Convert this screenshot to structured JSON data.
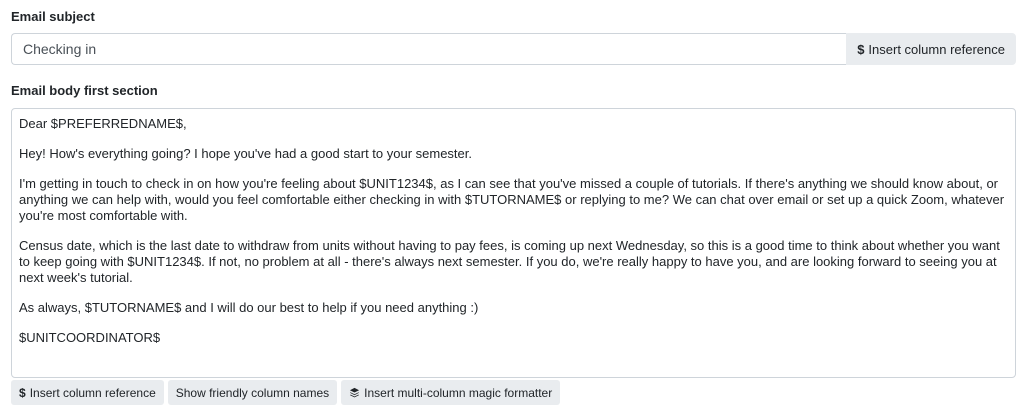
{
  "subject": {
    "label": "Email subject",
    "value": "Checking in",
    "insert_button_label": "Insert column reference"
  },
  "body": {
    "label": "Email body first section",
    "paragraphs": [
      "Dear $PREFERREDNAME$,",
      "Hey! How's everything going? I hope you've had a good start to your semester.",
      "I'm getting in touch to check in on how you're feeling about $UNIT1234$, as I can see that you've missed a couple of tutorials. If there's anything we should know about, or anything we can help with, would you feel comfortable either checking in with $TUTORNAME$ or replying to me? We can chat over email or set up a quick Zoom, whatever you're most comfortable with.",
      "Census date, which is the last date to withdraw from units without having to pay fees, is coming up next Wednesday, so this is a good time to think about whether you want to keep going with $UNIT1234$. If not, no problem at all - there's always next semester. If you do, we're really happy to have you, and are looking forward to seeing you at next week's tutorial.",
      "As always, $TUTORNAME$ and I will do our best to help if you need anything :)",
      "$UNITCOORDINATOR$"
    ]
  },
  "toolbar": {
    "insert_column_label": "Insert column reference",
    "friendly_names_label": "Show friendly column names",
    "magic_formatter_label": "Insert multi-column magic formatter"
  },
  "icons": {
    "dollar": "dollar-icon",
    "layers": "layers-icon"
  }
}
